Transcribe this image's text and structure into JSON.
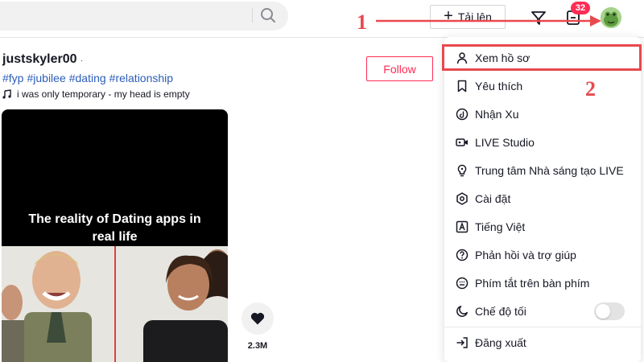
{
  "topbar": {
    "upload_label": "Tải lên",
    "inbox_badge": "32",
    "search_icon": "search-icon",
    "filter_icon": "send-filter-icon",
    "inbox_icon": "inbox-icon"
  },
  "post": {
    "author": "justskyler00",
    "author_dot": "·",
    "hashtags": [
      "#fyp",
      "#jubilee",
      "#dating",
      "#relationship"
    ],
    "music": "i was only temporary - my head is empty",
    "follow_label": "Follow",
    "video_caption_line1": "The reality of Dating apps in",
    "video_caption_line2": "real life",
    "like_count": "2.3M"
  },
  "menu": {
    "items": [
      {
        "label": "Xem hồ sơ",
        "icon": "person-icon"
      },
      {
        "label": "Yêu thích",
        "icon": "bookmark-icon"
      },
      {
        "label": "Nhận Xu",
        "icon": "coin-icon"
      },
      {
        "label": "LIVE Studio",
        "icon": "video-camera-icon"
      },
      {
        "label": "Trung tâm Nhà sáng tạo LIVE",
        "icon": "bulb-icon"
      },
      {
        "label": "Cài đặt",
        "icon": "gear-icon"
      },
      {
        "label": "Tiếng Việt",
        "icon": "language-icon"
      },
      {
        "label": "Phản hồi và trợ giúp",
        "icon": "help-icon"
      },
      {
        "label": "Phím tắt trên bàn phím",
        "icon": "keyboard-icon"
      },
      {
        "label": "Chế độ tối",
        "icon": "moon-icon"
      }
    ],
    "logout_label": "Đăng xuất",
    "dark_mode_on": false
  },
  "annotations": {
    "step1": "1",
    "step2": "2"
  },
  "colors": {
    "accent": "#fe2c55",
    "annotation": "#e8494e",
    "hashtag": "#2b5db9"
  }
}
